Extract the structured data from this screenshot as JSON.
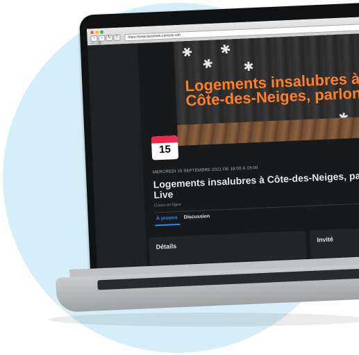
{
  "browser": {
    "url": "https://www.facebook.com/ulc.cdn",
    "bookmarks": "◁ ▢ ▤"
  },
  "cover": {
    "title_line1": "Logements insalubres à",
    "title_line2": "Côte-des-Neiges, parlons-e"
  },
  "event": {
    "day": "15",
    "date_line": "MERCREDI 15 SEPTEMBRE 2021 DE 18:00 À 19:00",
    "title": "Logements insalubres à Côte-des-Neiges, parlon Facebook Live",
    "subtitle": "Cours en ligne"
  },
  "tabs": [
    "À propos",
    "Discussion"
  ],
  "cards": {
    "details": "Détails",
    "invites": "Invité"
  },
  "colors": {
    "accent_blue": "#2d88ff",
    "title_orange": "#ff7f27",
    "date_red": "#f0284a",
    "page_bg": "#18191a"
  }
}
